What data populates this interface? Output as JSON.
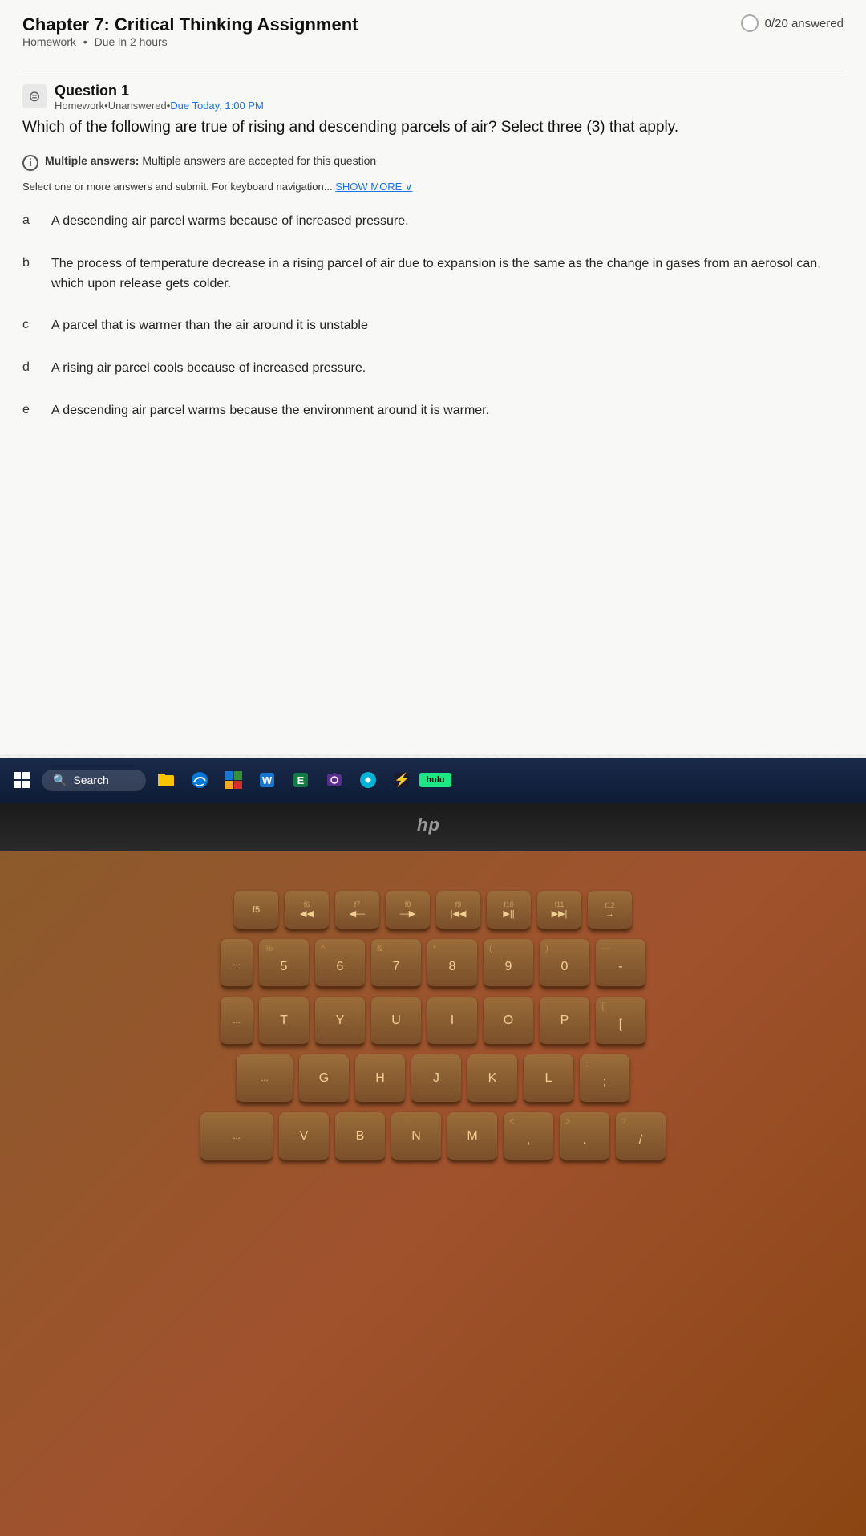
{
  "page": {
    "title": "Chapter 7: Critical Thinking Assignment",
    "subtitle": "Homework",
    "due": "Due in 2 hours",
    "progress": "0/20 answered"
  },
  "question": {
    "number": "Question 1",
    "type": "Homework",
    "status": "Unanswered",
    "due": "Due Today, 1:00 PM",
    "text": "Which of the following are true of rising and descending parcels of air? Select three (3) that apply.",
    "info_label": "Multiple answers:",
    "info_text": "Multiple answers are accepted for this question",
    "nav_text": "Select one or more answers and submit. For keyboard navigation...",
    "show_more": "SHOW MORE ∨"
  },
  "options": [
    {
      "letter": "a",
      "text": "A descending air parcel warms because of increased pressure."
    },
    {
      "letter": "b",
      "text": "The process of temperature decrease in a rising parcel of air due to expansion is the same as the change in gases from an aerosol can, which upon release gets colder."
    },
    {
      "letter": "c",
      "text": "A parcel that is warmer than the air around it is unstable"
    },
    {
      "letter": "d",
      "text": "A rising air parcel cools because of increased pressure."
    },
    {
      "letter": "e",
      "text": "A descending air parcel warms because the environment around it is warmer."
    }
  ],
  "taskbar": {
    "search_label": "Search",
    "hulu_label": "hulu"
  },
  "keyboard": {
    "rows": [
      [
        "f5",
        "f6 ◀◀",
        "f7 ◀—",
        "f8 —▶",
        "f9 |◀◀",
        "f10 ▶||",
        "f11 ▶▶|",
        "f12 →"
      ],
      [
        "%\n5",
        "^\n6",
        "&\n7",
        "*\n8",
        "(\n9",
        ")\n0",
        "—\n-"
      ],
      [
        "T",
        "Y",
        "U",
        "I",
        "O",
        "P",
        "{"
      ],
      [
        "G",
        "H",
        "J",
        "K",
        "L",
        ":",
        ";"
      ],
      [
        "V",
        "B",
        "N",
        "M",
        "<\n,",
        ">\n.",
        "?"
      ]
    ],
    "hp_logo": "hp"
  },
  "colors": {
    "screen_bg": "#f8f8f6",
    "taskbar_bg": "#0d1b35",
    "keyboard_bg": "#8B5A2B",
    "key_bg": "#9B6D3A",
    "accent_blue": "#1a73e8",
    "hulu_green": "#1CE783"
  }
}
